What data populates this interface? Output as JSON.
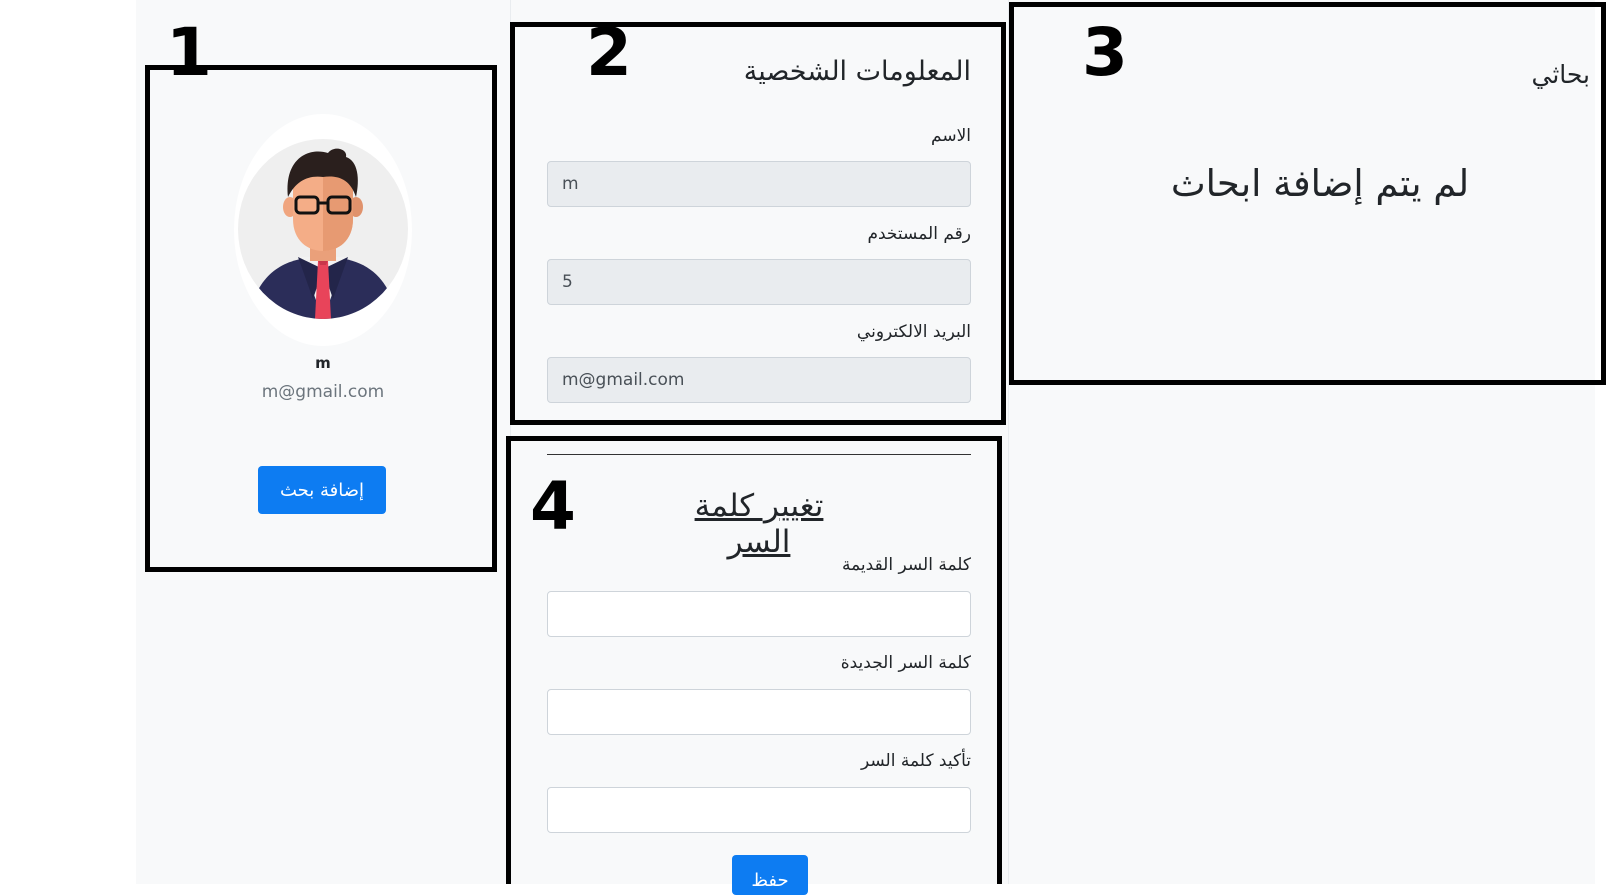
{
  "profile": {
    "name": "m",
    "email": "m@gmail.com",
    "add_research_label": "إضافة بحث"
  },
  "personal_info": {
    "title": "المعلومات الشخصية",
    "fields": [
      {
        "label": "الاسم",
        "value": "m"
      },
      {
        "label": "رقم المستخدم",
        "value": "5"
      },
      {
        "label": "البريد الالكتروني",
        "value": "m@gmail.com"
      }
    ]
  },
  "my_research": {
    "title": "بحاثي",
    "empty_message": "لم يتم إضافة ابحاث"
  },
  "change_password": {
    "title": "تغيير كلمة السر",
    "fields": [
      {
        "label": "كلمة السر القديمة",
        "value": ""
      },
      {
        "label": "كلمة السر الجديدة",
        "value": ""
      },
      {
        "label": "تأكيد كلمة السر",
        "value": ""
      }
    ],
    "save_label": "حفظ"
  },
  "annotations": [
    "1",
    "2",
    "3",
    "4"
  ],
  "colors": {
    "primary": "#0d7cf2",
    "page_bg": "#f8f9fa",
    "field_readonly_bg": "#e9ecef",
    "tie": "#e8445a",
    "suit": "#2b2d59"
  },
  "icons": {
    "avatar": "businessman-avatar-icon"
  }
}
